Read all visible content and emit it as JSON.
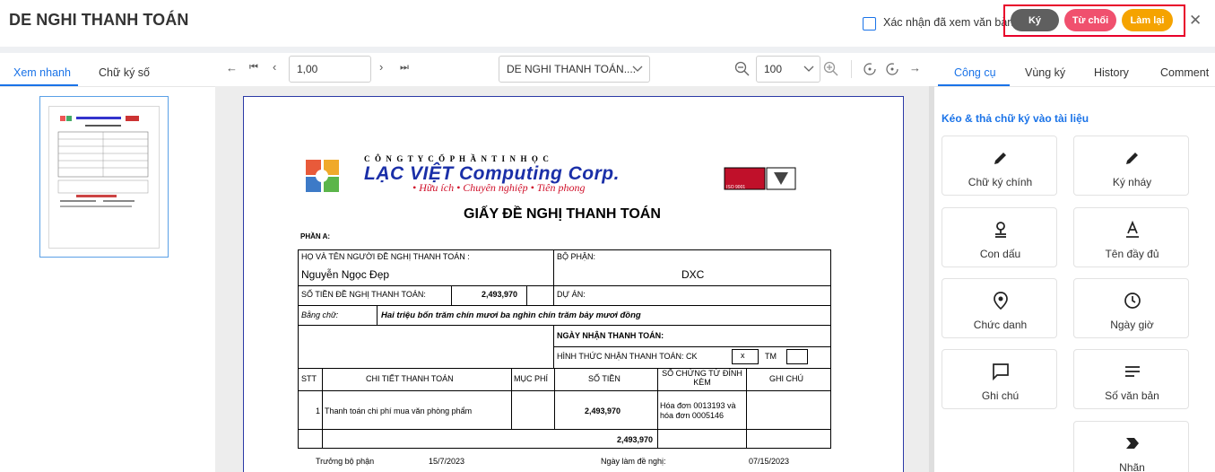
{
  "header": {
    "title": "DE NGHI THANH TOÁN",
    "confirm_label": "Xác nhận đã xem văn bản",
    "btn_sign": "Ký",
    "btn_reject": "Từ chối",
    "btn_redo": "Làm lại",
    "close": "✕"
  },
  "left_tabs": [
    "Xem nhanh",
    "Chữ ký số"
  ],
  "toolbar": {
    "page_value": "1,00",
    "doc_select": "DE NGHI THANH TOÁN....",
    "zoom_value": "100"
  },
  "right_tabs": [
    "Công cụ",
    "Vùng ký",
    "History",
    "Comment"
  ],
  "right_panel": {
    "hint": "Kéo & thả chữ ký vào tài liệu",
    "tools": [
      {
        "label": "Chữ ký chính",
        "icon": "pen-icon"
      },
      {
        "label": "Ký nháy",
        "icon": "pen-icon"
      },
      {
        "label": "Con dấu",
        "icon": "stamp-icon"
      },
      {
        "label": "Tên đầy đủ",
        "icon": "text-a-icon"
      },
      {
        "label": "Chức danh",
        "icon": "badge-icon"
      },
      {
        "label": "Ngày giờ",
        "icon": "clock-icon"
      },
      {
        "label": "Ghi chú",
        "icon": "comment-icon"
      },
      {
        "label": "Số văn bản",
        "icon": "lines-icon"
      },
      {
        "label": "Nhãn",
        "icon": "label-icon"
      }
    ]
  },
  "document": {
    "company_line": "C Ô N G   T Y   C Ổ   P H Ầ N   T I N   H Ọ C",
    "company_name": "LẠC VIỆT Computing Corp.",
    "slogan": "• Hữu ích  • Chuyên nghiệp  • Tiên phong",
    "form_title": "GIẤY ĐỀ NGHỊ THANH TOÁN",
    "phan_a": "PHẦN A:",
    "ho_ten_label": "HỌ VÀ TÊN NGƯỜI ĐỀ NGHỊ THANH TOÁN :",
    "ho_ten_value": "Nguyễn Ngọc Đẹp",
    "bo_phan_label": "BỘ PHẬN:",
    "bo_phan_value": "DXC",
    "so_tien_label": "SỐ TIỀN ĐỀ NGHỊ THANH TOÁN:",
    "so_tien_value": "2,493,970",
    "du_an_label": "DỰ ÁN:",
    "bang_chu_label": "Bằng chữ:",
    "bang_chu_value": "Hai triệu bốn trăm chín mươi ba nghìn chín trăm bảy mươi đồng",
    "ngay_nhan_label": "NGÀY NHẬN THANH TOÁN:",
    "hinh_thuc_label": "HÌNH THỨC NHẬN THANH TOÁN: CK",
    "ck_mark": "x",
    "tm_label": "TM",
    "col_headers": [
      "STT",
      "CHI TIẾT THANH TOÁN",
      "MỤC PHÍ",
      "SỐ TIỀN",
      "SỐ CHỨNG TỪ ĐÍNH KÈM",
      "GHI CHÚ"
    ],
    "row": {
      "stt": "1",
      "detail": "Thanh toán chi phí mua văn phòng phẩm",
      "amount": "2,493,970",
      "voucher_1": "Hóa đơn 0013193 và",
      "voucher_2": "hóa đơn 0005146"
    },
    "total": "2,493,970",
    "footer_left": "Trưởng bộ phận",
    "footer_date": "15/7/2023",
    "footer_req": "Ngày làm đề nghị:",
    "footer_req_date": "07/15/2023",
    "cert_badge": "ISO 9001"
  },
  "colors": {
    "accent": "#1a73e8",
    "sign": "#5f5f5f",
    "reject": "#f0506e",
    "redo": "#f5a300",
    "highlight_box": "#e8002a"
  }
}
